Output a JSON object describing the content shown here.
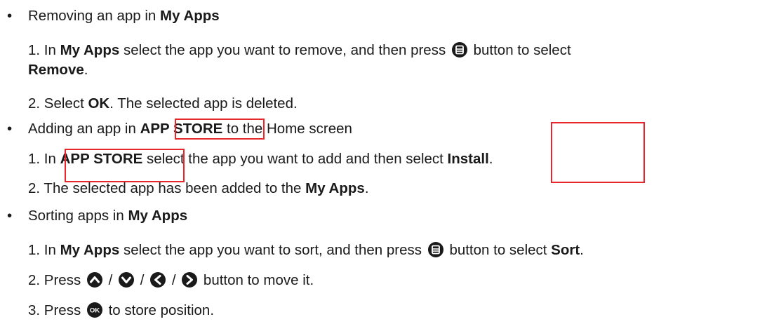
{
  "bullet": "•",
  "sections": [
    {
      "heading": {
        "text": "Removing an app in ",
        "bold": "My Apps"
      },
      "steps": [
        {
          "a": "1. In ",
          "b1": "My Apps",
          "c": " select the app you want to remove, and then press ",
          "d": " button to select",
          "b2": "Remove",
          "e": "."
        },
        {
          "a": "2. Select ",
          "b1": "OK",
          "c": ". The selected app is deleted."
        }
      ]
    },
    {
      "heading": {
        "text": "Adding an app in ",
        "bold": "APP STORE",
        "tail": " to the Home screen"
      },
      "steps": [
        {
          "a": "1. In ",
          "b1": "APP STORE",
          "c": " select the app you want to add and then select ",
          "b2": "Install",
          "e": "."
        },
        {
          "a": "2. The selected app has been added to the ",
          "b1": "My Apps",
          "c": "."
        }
      ]
    },
    {
      "heading": {
        "text": "Sorting apps in ",
        "bold": "My Apps"
      },
      "steps": [
        {
          "a": "1. In ",
          "b1": "My Apps",
          "c": " select the app you want to sort, and then press ",
          "d": " button to select ",
          "b2": "Sort",
          "e": "."
        },
        {
          "a": "2. Press ",
          "sep": " / ",
          "c": " button to move it."
        },
        {
          "a": "3. Press ",
          "c": " to store position."
        }
      ]
    }
  ],
  "icons": {
    "menu": "menu-button-icon",
    "up": "up-arrow-icon",
    "down": "down-arrow-icon",
    "left": "left-arrow-icon",
    "right": "right-arrow-icon",
    "ok": "ok-button-icon",
    "ok_label": "OK"
  },
  "colors": {
    "text": "#1a1a1a",
    "icon": "#1a1a1a",
    "highlight": "#e8262b"
  }
}
